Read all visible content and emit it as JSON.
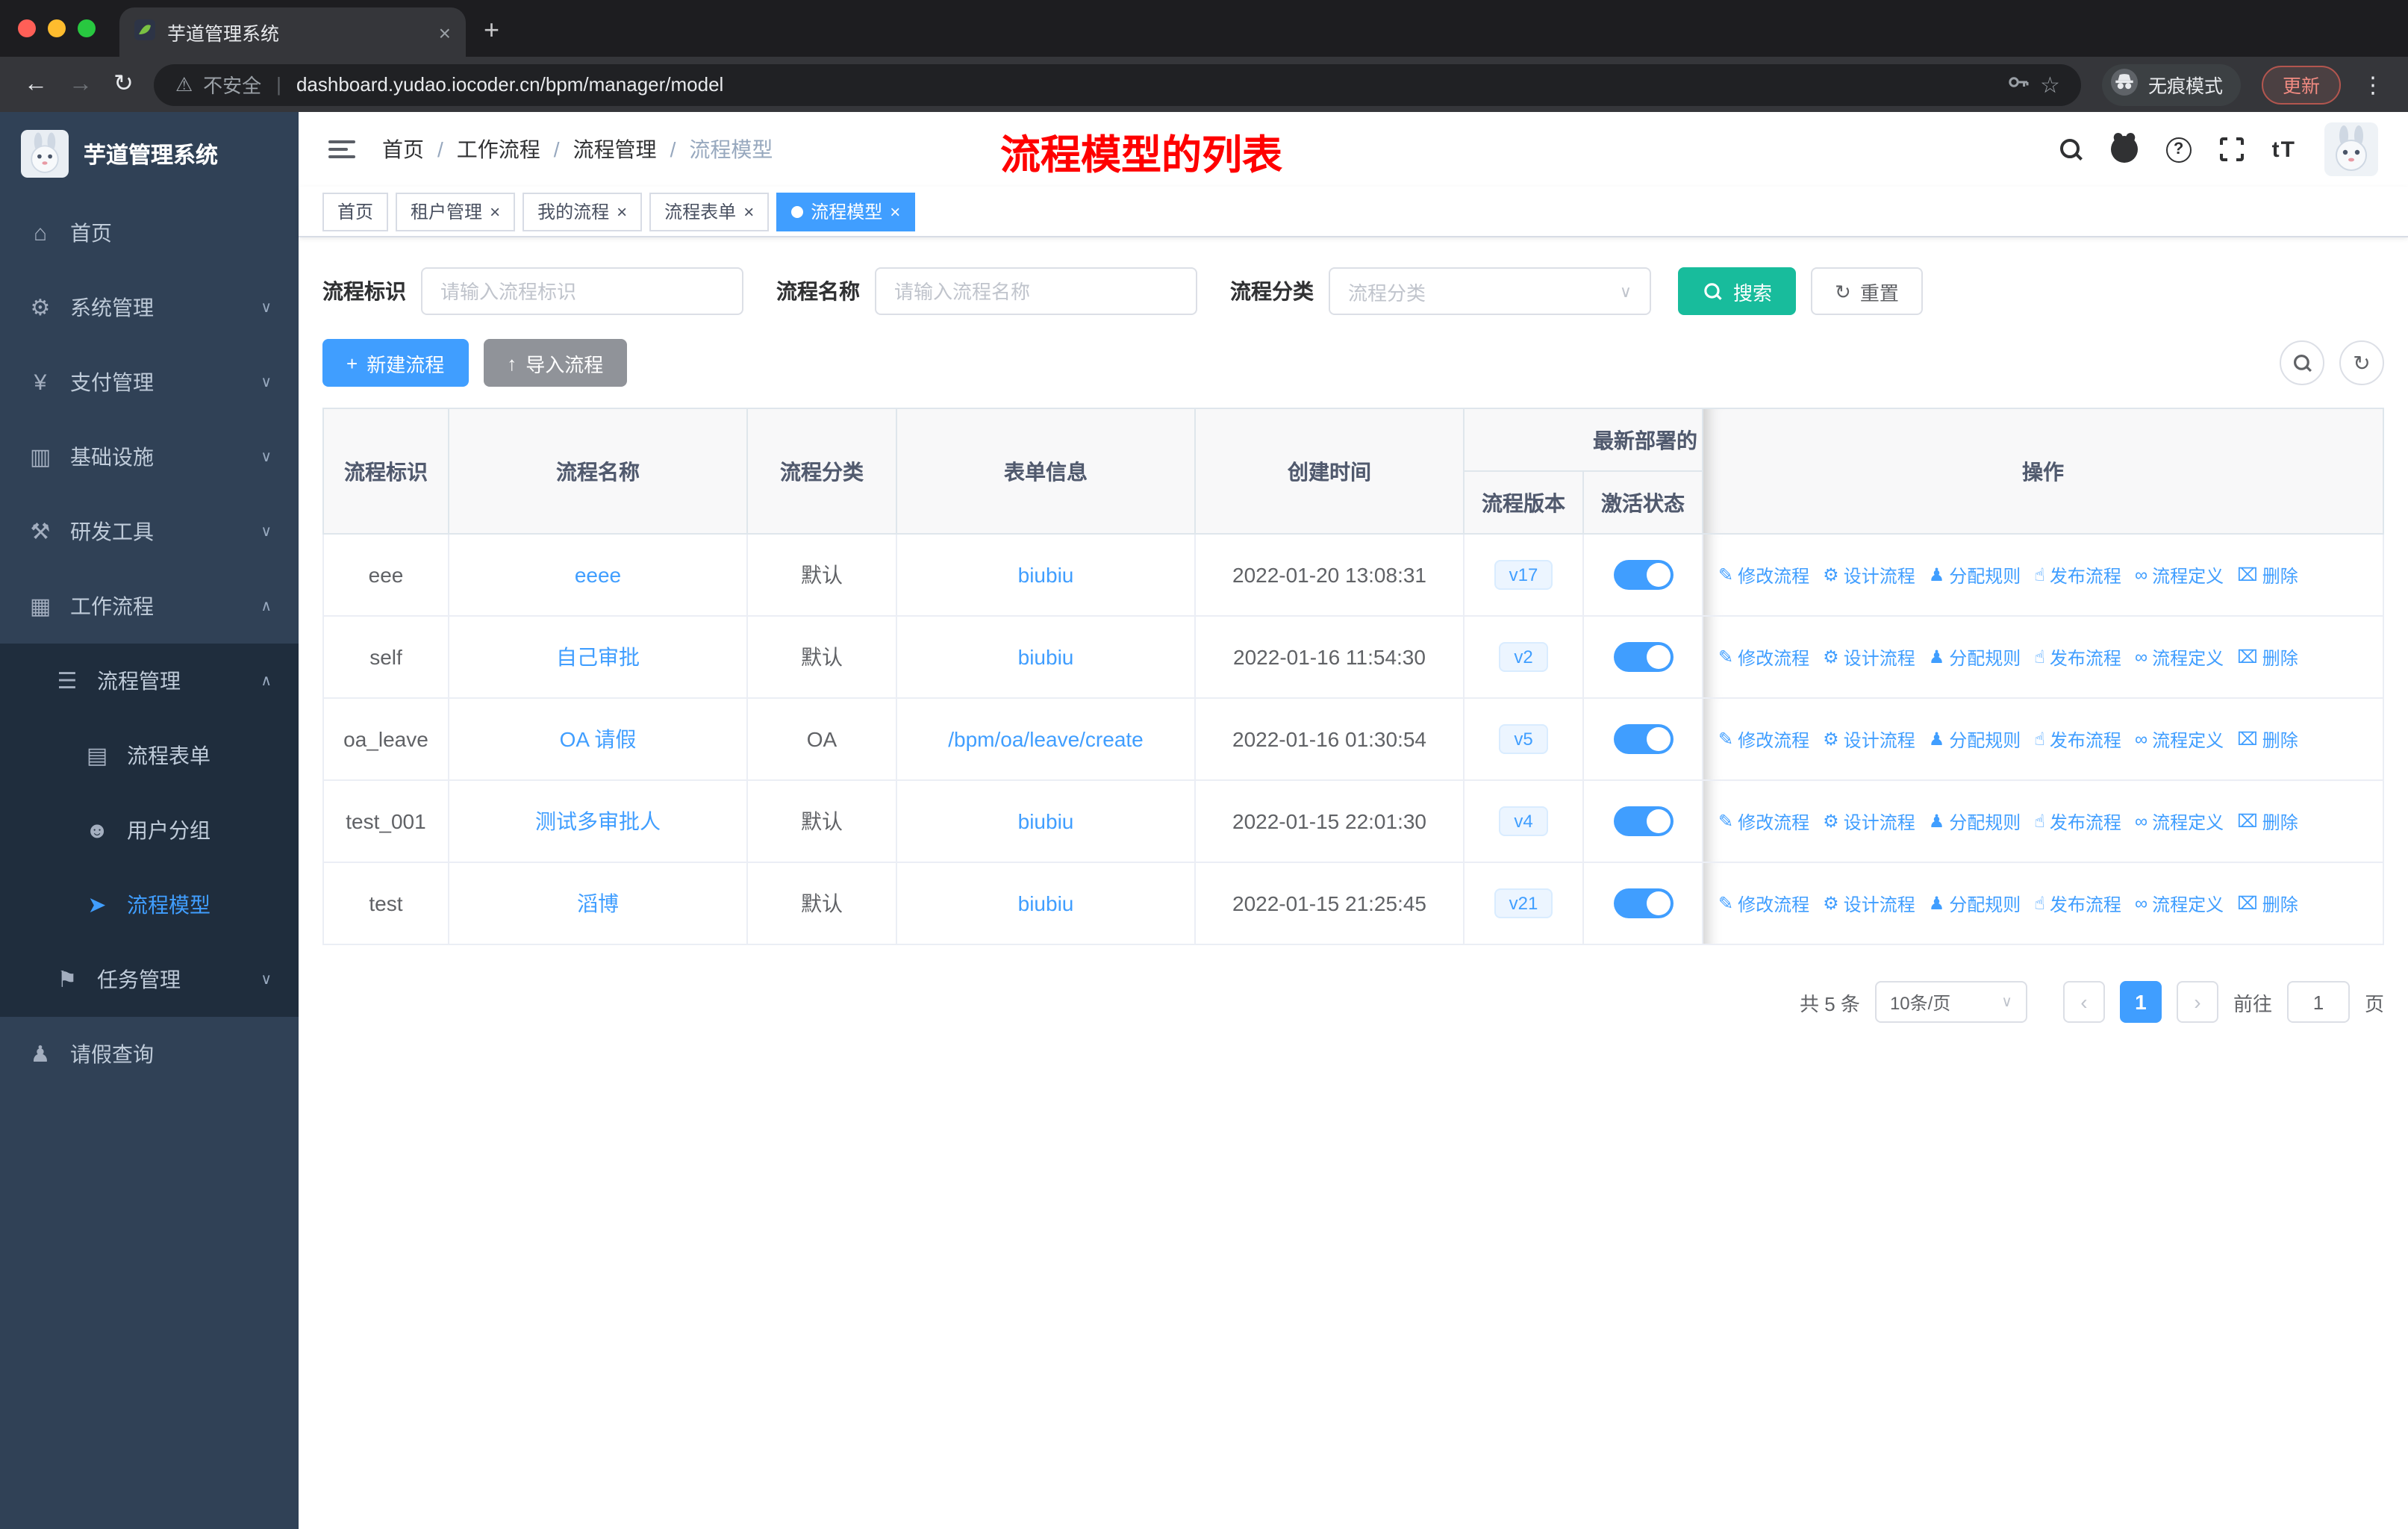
{
  "browser": {
    "tab_title": "芋道管理系统",
    "security_label": "不安全",
    "url": "dashboard.yudao.iocoder.cn/bpm/manager/model",
    "incognito_label": "无痕模式",
    "update_label": "更新"
  },
  "sidebar": {
    "logo_title": "芋道管理系统",
    "items": [
      {
        "label": "首页"
      },
      {
        "label": "系统管理"
      },
      {
        "label": "支付管理"
      },
      {
        "label": "基础设施"
      },
      {
        "label": "研发工具"
      },
      {
        "label": "工作流程"
      },
      {
        "label": "流程管理"
      },
      {
        "label": "流程表单"
      },
      {
        "label": "用户分组"
      },
      {
        "label": "流程模型"
      },
      {
        "label": "任务管理"
      },
      {
        "label": "请假查询"
      }
    ]
  },
  "header": {
    "breadcrumb": [
      "首页",
      "工作流程",
      "流程管理",
      "流程模型"
    ],
    "annotation": "流程模型的列表",
    "font_size_icon_text": "tT"
  },
  "tags": [
    {
      "label": "首页"
    },
    {
      "label": "租户管理"
    },
    {
      "label": "我的流程"
    },
    {
      "label": "流程表单"
    },
    {
      "label": "流程模型"
    }
  ],
  "filters": {
    "key_label": "流程标识",
    "key_placeholder": "请输入流程标识",
    "name_label": "流程名称",
    "name_placeholder": "请输入流程名称",
    "category_label": "流程分类",
    "category_placeholder": "流程分类",
    "search_label": "搜索",
    "reset_label": "重置"
  },
  "toolbar": {
    "create_label": "新建流程",
    "import_label": "导入流程"
  },
  "table": {
    "headers": {
      "key": "流程标识",
      "name": "流程名称",
      "category": "流程分类",
      "form": "表单信息",
      "created": "创建时间",
      "deployment_group": "最新部署的",
      "version": "流程版本",
      "status": "激活状态",
      "actions": "操作"
    },
    "rows": [
      {
        "key": "eee",
        "name": "eeee",
        "category": "默认",
        "form": "biubiu",
        "created": "2022-01-20 13:08:31",
        "version": "v17",
        "active": true
      },
      {
        "key": "self",
        "name": "自己审批",
        "category": "默认",
        "form": "biubiu",
        "created": "2022-01-16 11:54:30",
        "version": "v2",
        "active": true
      },
      {
        "key": "oa_leave",
        "name": "OA 请假",
        "category": "OA",
        "form": "/bpm/oa/leave/create",
        "created": "2022-01-16 01:30:54",
        "version": "v5",
        "active": true
      },
      {
        "key": "test_001",
        "name": "测试多审批人",
        "category": "默认",
        "form": "biubiu",
        "created": "2022-01-15 22:01:30",
        "version": "v4",
        "active": true
      },
      {
        "key": "test",
        "name": "滔博",
        "category": "默认",
        "form": "biubiu",
        "created": "2022-01-15 21:25:45",
        "version": "v21",
        "active": true
      }
    ],
    "row_actions": [
      {
        "label": "修改流程",
        "name": "modify-process-action",
        "icon": "edit-icon"
      },
      {
        "label": "设计流程",
        "name": "design-process-action",
        "icon": "design-icon"
      },
      {
        "label": "分配规则",
        "name": "assign-rule-action",
        "icon": "assign-user-icon"
      },
      {
        "label": "发布流程",
        "name": "publish-process-action",
        "icon": "publish-icon"
      },
      {
        "label": "流程定义",
        "name": "process-definition-action",
        "icon": "definition-icon"
      },
      {
        "label": "删除",
        "name": "delete-action",
        "icon": "trash-icon"
      }
    ]
  },
  "pagination": {
    "total_text": "共 5 条",
    "page_size_text": "10条/页",
    "current_page": "1",
    "goto_label": "前往",
    "goto_value": "1",
    "page_unit": "页"
  },
  "glyphs": {
    "home-icon": "⌂",
    "system-icon": "⚙",
    "pay-icon": "¥",
    "infra-icon": "▥",
    "devtools-icon": "⚒",
    "workflow-icon": "▦",
    "process-mgmt-icon": "☰",
    "process-form-icon": "▤",
    "user-group-icon": "☻",
    "process-model-icon": "➤",
    "task-mgmt-icon": "⚑",
    "leave-query-icon": "♟",
    "chevron-down": "∨",
    "chevron-up": "∧",
    "edit-icon": "✎",
    "design-icon": "⚙",
    "assign-user-icon": "♟",
    "publish-icon": "☝",
    "definition-icon": "∞",
    "trash-icon": "⌧",
    "plus-icon": "+",
    "upload-icon": "↑",
    "refresh-icon": "↻",
    "close-icon": "×",
    "back-icon": "←",
    "forward-icon": "→",
    "reload-icon": "↻",
    "star-icon": "☆",
    "warning-icon": "⚠",
    "menu-dots-icon": "⋮",
    "divider": "|",
    "prev-icon": "‹",
    "next-icon": "›",
    "select-chevron": "∨",
    "breadcrumb-sep": "/",
    "help-icon": "?",
    "new-tab-icon": "+"
  }
}
